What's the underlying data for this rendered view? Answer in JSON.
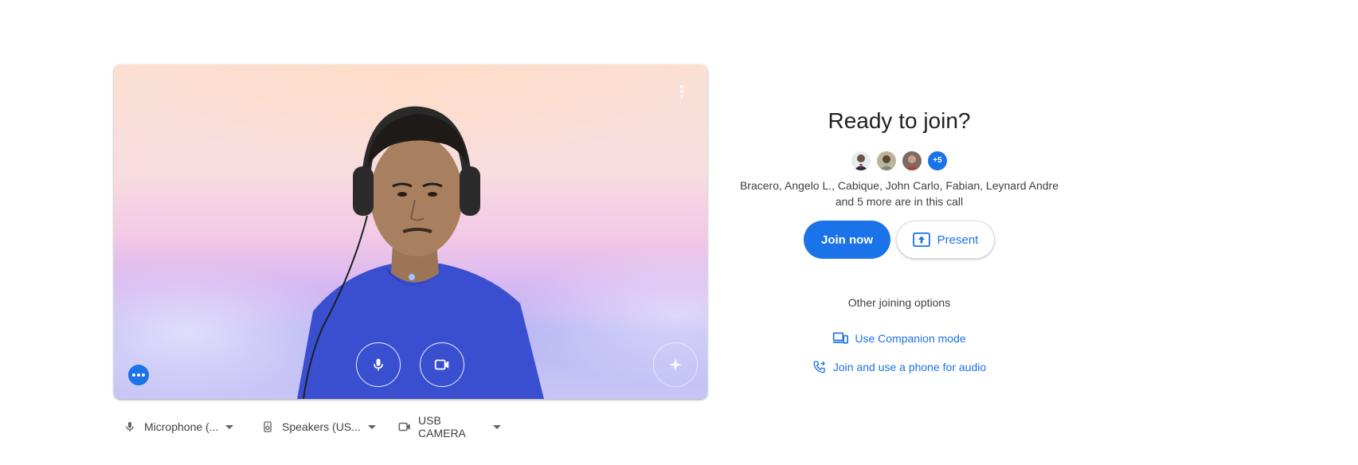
{
  "preview": {
    "more_options_icon": "more-vert-icon",
    "mic_icon": "microphone-icon",
    "camera_icon": "videocam-icon",
    "effects_icon": "sparkle-icon",
    "dots_icon": "more-horiz-icon"
  },
  "devices": {
    "microphone": "Microphone (...",
    "speakers": "Speakers (US...",
    "camera": "USB CAMERA"
  },
  "join": {
    "title": "Ready to join?",
    "more_count": "+5",
    "participants_line1": "Bracero, Angelo L., Cabique, John Carlo, Fabian, Leynard Andre",
    "participants_line2": "and 5 more are in this call",
    "join_now": "Join now",
    "present": "Present",
    "other_options": "Other joining options",
    "companion_mode": "Use Companion mode",
    "phone_audio": "Join and use a phone for audio"
  },
  "colors": {
    "accent": "#1a73e8",
    "text": "#202124"
  }
}
